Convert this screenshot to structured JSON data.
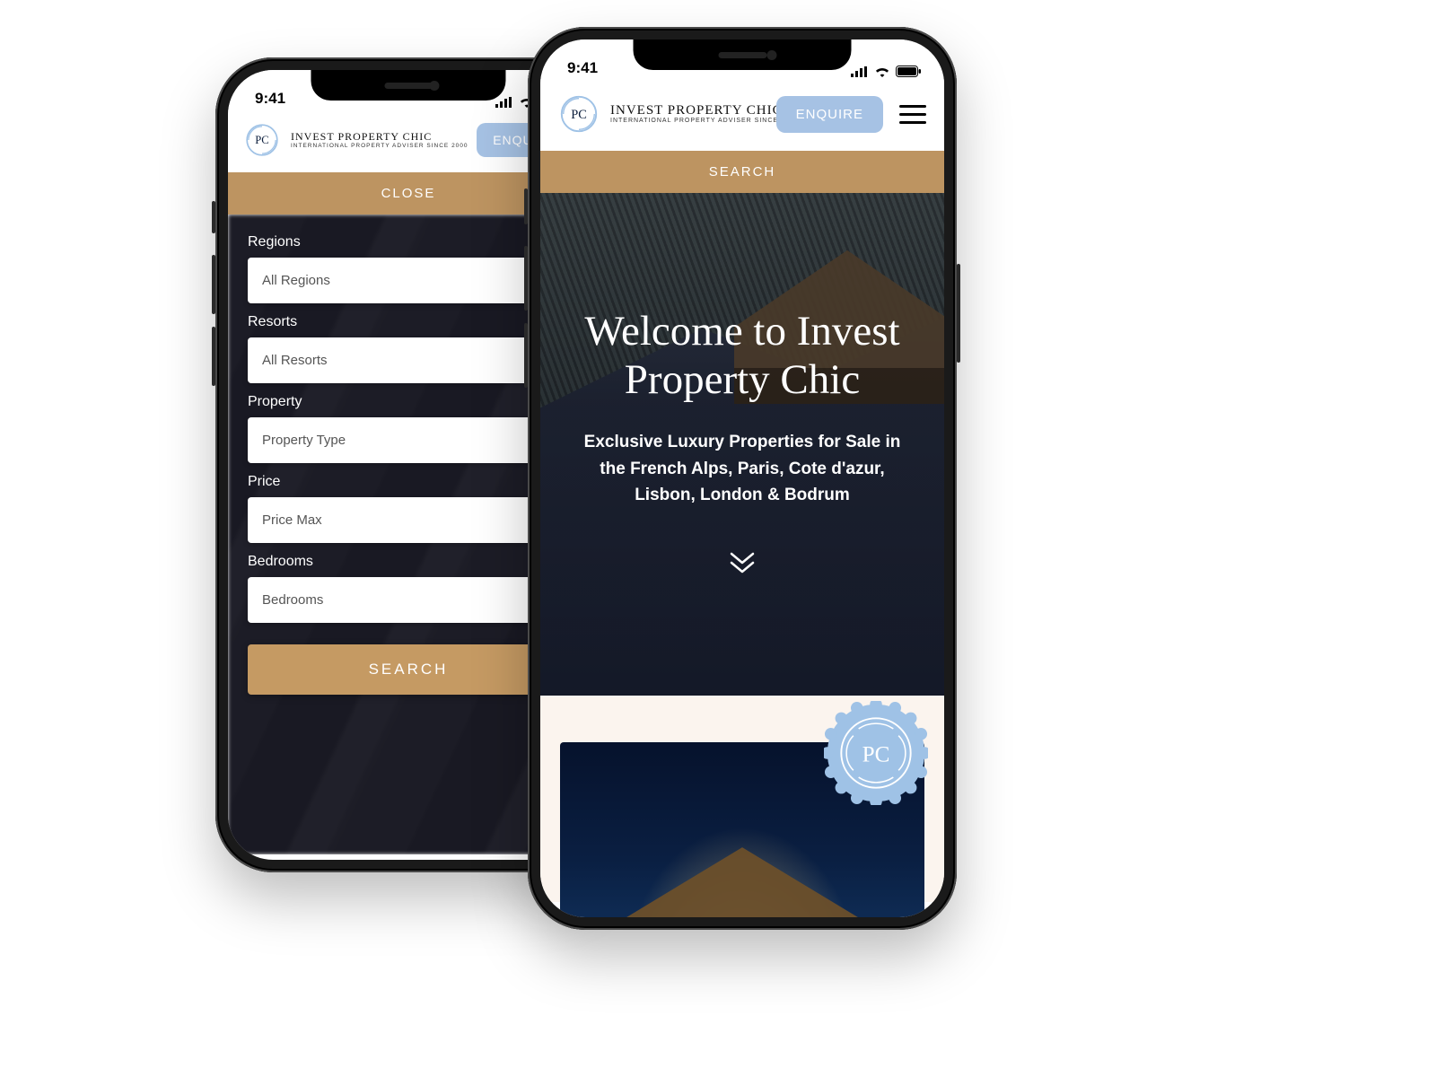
{
  "colors": {
    "gold": "#bd9461",
    "gold_btn": "#c59a63",
    "blue": "#a6c2e4",
    "seal": "#9fc2e6"
  },
  "status": {
    "time": "9:41"
  },
  "brand": {
    "title": "INVEST PROPERTY CHIC",
    "subtitle": "INTERNATIONAL PROPERTY ADVISER SINCE 2000",
    "mark": "PC"
  },
  "header": {
    "enquire": "ENQUIRE"
  },
  "phone1": {
    "band": "CLOSE",
    "filters": {
      "regions": {
        "label": "Regions",
        "value": "All Regions"
      },
      "resorts": {
        "label": "Resorts",
        "value": "All Resorts"
      },
      "property": {
        "label": "Property",
        "value": "Property Type"
      },
      "price": {
        "label": "Price",
        "value": "Price Max"
      },
      "bedrooms": {
        "label": "Bedrooms",
        "value": "Bedrooms"
      }
    },
    "search": "SEARCH"
  },
  "phone2": {
    "band": "SEARCH",
    "hero": {
      "title": "Welcome to Invest Property Chic",
      "subtitle": "Exclusive Luxury Properties for Sale in the French Alps, Paris, Cote d'azur, Lisbon, London & Bodrum"
    }
  }
}
